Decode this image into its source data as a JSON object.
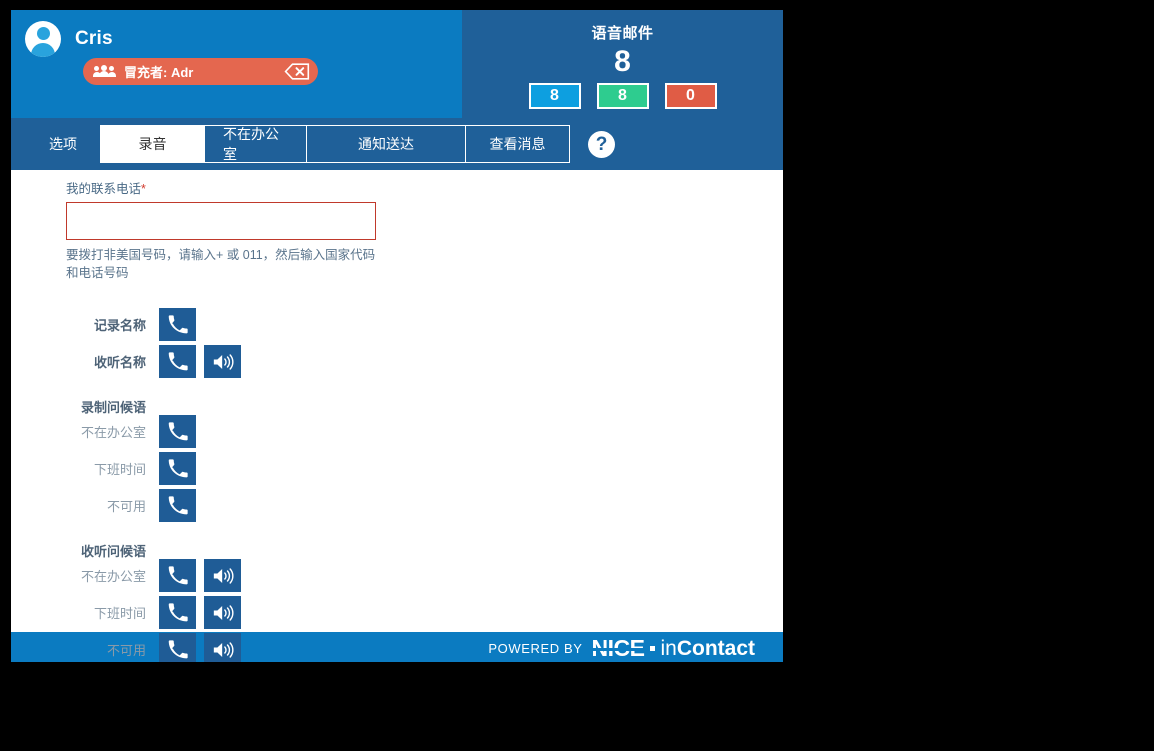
{
  "header": {
    "user_name": "Cris",
    "avatar_icon": "user-avatar-icon",
    "impersonation": {
      "people_icon": "people-group-icon",
      "label": "冒充者: Adr",
      "close_icon": "delete-x-icon"
    }
  },
  "voicemail": {
    "title": "语音邮件",
    "total": "8",
    "badges": [
      {
        "value": "8",
        "color": "#0d9fe0",
        "name": "voicemail-badge-new"
      },
      {
        "value": "8",
        "color": "#2ecc8f",
        "name": "voicemail-badge-saved"
      },
      {
        "value": "0",
        "color": "#e05c45",
        "name": "voicemail-badge-urgent"
      }
    ]
  },
  "tabs": {
    "options_label": "选项",
    "items": [
      {
        "label": "录音",
        "active": true
      },
      {
        "label": "不在办公室",
        "active": false
      },
      {
        "label": "通知送达",
        "active": false
      },
      {
        "label": "查看消息",
        "active": false
      }
    ],
    "help_label": "?"
  },
  "form": {
    "phone_label": "我的联系电话",
    "required_mark": "*",
    "phone_value": "",
    "phone_placeholder": "",
    "phone_hint": "要拨打非美国号码，请输入+ 或 011，然后输入国家代码和电话号码"
  },
  "rows": {
    "record_name": {
      "label": "记录名称",
      "call_icon": "phone-handset-icon"
    },
    "listen_name": {
      "label": "收听名称",
      "call_icon": "phone-handset-icon",
      "play_icon": "speaker-volume-icon"
    },
    "record_greetings_header": "录制问候语",
    "record_greetings": [
      {
        "label": "不在办公室",
        "call_icon": "phone-handset-icon"
      },
      {
        "label": "下班时间",
        "call_icon": "phone-handset-icon"
      },
      {
        "label": "不可用",
        "call_icon": "phone-handset-icon"
      }
    ],
    "listen_greetings_header": "收听问候语",
    "listen_greetings": [
      {
        "label": "不在办公室",
        "call_icon": "phone-handset-icon",
        "play_icon": "speaker-volume-icon"
      },
      {
        "label": "下班时间",
        "call_icon": "phone-handset-icon",
        "play_icon": "speaker-volume-icon"
      },
      {
        "label": "不可用",
        "call_icon": "phone-handset-icon",
        "play_icon": "speaker-volume-icon"
      }
    ]
  },
  "footer": {
    "powered_by": "POWERED BY",
    "brand_nice": "NICE",
    "brand_in": "in",
    "brand_contact": "Contact"
  },
  "colors": {
    "header_blue": "#0b7bc1",
    "panel_blue": "#1f6099",
    "button_blue": "#1f5c96",
    "badge_red": "#e4674f",
    "required_red": "#d23b2e"
  }
}
